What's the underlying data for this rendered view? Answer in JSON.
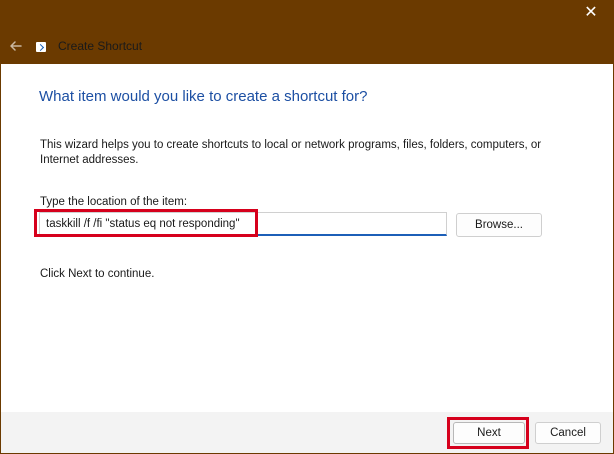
{
  "window": {
    "title": "Create Shortcut",
    "close_glyph": "✕"
  },
  "icons": {
    "back": "back-arrow-icon",
    "app": "shortcut-icon",
    "close": "close-icon"
  },
  "page": {
    "heading": "What item would you like to create a shortcut for?",
    "description": "This wizard helps you to create shortcuts to local or network programs, files, folders, computers, or Internet addresses.",
    "location_label": "Type the location of the item:",
    "location_value": "taskkill /f /fi \"status eq not responding\"",
    "browse_label": "Browse...",
    "hint": "Click Next to continue."
  },
  "footer": {
    "next_label": "Next",
    "cancel_label": "Cancel"
  },
  "colors": {
    "titlebar": "#6b3a00",
    "heading": "#1c4fa3",
    "highlight": "#d6001c",
    "input_accent": "#1c5fb8"
  }
}
